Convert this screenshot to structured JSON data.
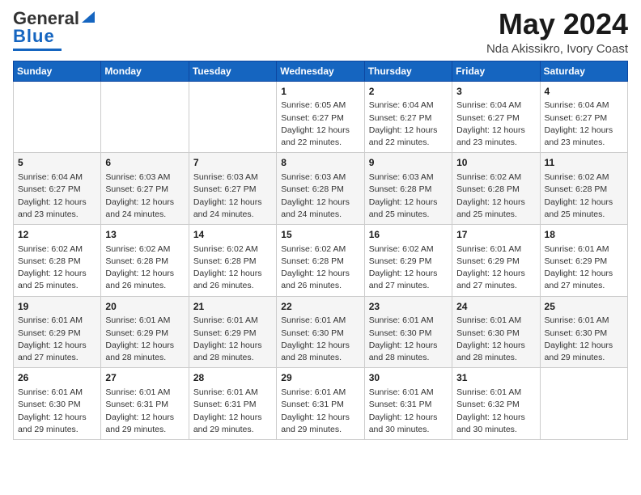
{
  "header": {
    "logo_general": "General",
    "logo_blue": "Blue",
    "title": "May 2024",
    "subtitle": "Nda Akissikro, Ivory Coast"
  },
  "calendar": {
    "weekdays": [
      "Sunday",
      "Monday",
      "Tuesday",
      "Wednesday",
      "Thursday",
      "Friday",
      "Saturday"
    ],
    "weeks": [
      [
        {
          "day": "",
          "info": ""
        },
        {
          "day": "",
          "info": ""
        },
        {
          "day": "",
          "info": ""
        },
        {
          "day": "1",
          "info": "Sunrise: 6:05 AM\nSunset: 6:27 PM\nDaylight: 12 hours\nand 22 minutes."
        },
        {
          "day": "2",
          "info": "Sunrise: 6:04 AM\nSunset: 6:27 PM\nDaylight: 12 hours\nand 22 minutes."
        },
        {
          "day": "3",
          "info": "Sunrise: 6:04 AM\nSunset: 6:27 PM\nDaylight: 12 hours\nand 23 minutes."
        },
        {
          "day": "4",
          "info": "Sunrise: 6:04 AM\nSunset: 6:27 PM\nDaylight: 12 hours\nand 23 minutes."
        }
      ],
      [
        {
          "day": "5",
          "info": "Sunrise: 6:04 AM\nSunset: 6:27 PM\nDaylight: 12 hours\nand 23 minutes."
        },
        {
          "day": "6",
          "info": "Sunrise: 6:03 AM\nSunset: 6:27 PM\nDaylight: 12 hours\nand 24 minutes."
        },
        {
          "day": "7",
          "info": "Sunrise: 6:03 AM\nSunset: 6:27 PM\nDaylight: 12 hours\nand 24 minutes."
        },
        {
          "day": "8",
          "info": "Sunrise: 6:03 AM\nSunset: 6:28 PM\nDaylight: 12 hours\nand 24 minutes."
        },
        {
          "day": "9",
          "info": "Sunrise: 6:03 AM\nSunset: 6:28 PM\nDaylight: 12 hours\nand 25 minutes."
        },
        {
          "day": "10",
          "info": "Sunrise: 6:02 AM\nSunset: 6:28 PM\nDaylight: 12 hours\nand 25 minutes."
        },
        {
          "day": "11",
          "info": "Sunrise: 6:02 AM\nSunset: 6:28 PM\nDaylight: 12 hours\nand 25 minutes."
        }
      ],
      [
        {
          "day": "12",
          "info": "Sunrise: 6:02 AM\nSunset: 6:28 PM\nDaylight: 12 hours\nand 25 minutes."
        },
        {
          "day": "13",
          "info": "Sunrise: 6:02 AM\nSunset: 6:28 PM\nDaylight: 12 hours\nand 26 minutes."
        },
        {
          "day": "14",
          "info": "Sunrise: 6:02 AM\nSunset: 6:28 PM\nDaylight: 12 hours\nand 26 minutes."
        },
        {
          "day": "15",
          "info": "Sunrise: 6:02 AM\nSunset: 6:28 PM\nDaylight: 12 hours\nand 26 minutes."
        },
        {
          "day": "16",
          "info": "Sunrise: 6:02 AM\nSunset: 6:29 PM\nDaylight: 12 hours\nand 27 minutes."
        },
        {
          "day": "17",
          "info": "Sunrise: 6:01 AM\nSunset: 6:29 PM\nDaylight: 12 hours\nand 27 minutes."
        },
        {
          "day": "18",
          "info": "Sunrise: 6:01 AM\nSunset: 6:29 PM\nDaylight: 12 hours\nand 27 minutes."
        }
      ],
      [
        {
          "day": "19",
          "info": "Sunrise: 6:01 AM\nSunset: 6:29 PM\nDaylight: 12 hours\nand 27 minutes."
        },
        {
          "day": "20",
          "info": "Sunrise: 6:01 AM\nSunset: 6:29 PM\nDaylight: 12 hours\nand 28 minutes."
        },
        {
          "day": "21",
          "info": "Sunrise: 6:01 AM\nSunset: 6:29 PM\nDaylight: 12 hours\nand 28 minutes."
        },
        {
          "day": "22",
          "info": "Sunrise: 6:01 AM\nSunset: 6:30 PM\nDaylight: 12 hours\nand 28 minutes."
        },
        {
          "day": "23",
          "info": "Sunrise: 6:01 AM\nSunset: 6:30 PM\nDaylight: 12 hours\nand 28 minutes."
        },
        {
          "day": "24",
          "info": "Sunrise: 6:01 AM\nSunset: 6:30 PM\nDaylight: 12 hours\nand 28 minutes."
        },
        {
          "day": "25",
          "info": "Sunrise: 6:01 AM\nSunset: 6:30 PM\nDaylight: 12 hours\nand 29 minutes."
        }
      ],
      [
        {
          "day": "26",
          "info": "Sunrise: 6:01 AM\nSunset: 6:30 PM\nDaylight: 12 hours\nand 29 minutes."
        },
        {
          "day": "27",
          "info": "Sunrise: 6:01 AM\nSunset: 6:31 PM\nDaylight: 12 hours\nand 29 minutes."
        },
        {
          "day": "28",
          "info": "Sunrise: 6:01 AM\nSunset: 6:31 PM\nDaylight: 12 hours\nand 29 minutes."
        },
        {
          "day": "29",
          "info": "Sunrise: 6:01 AM\nSunset: 6:31 PM\nDaylight: 12 hours\nand 29 minutes."
        },
        {
          "day": "30",
          "info": "Sunrise: 6:01 AM\nSunset: 6:31 PM\nDaylight: 12 hours\nand 30 minutes."
        },
        {
          "day": "31",
          "info": "Sunrise: 6:01 AM\nSunset: 6:32 PM\nDaylight: 12 hours\nand 30 minutes."
        },
        {
          "day": "",
          "info": ""
        }
      ]
    ]
  }
}
